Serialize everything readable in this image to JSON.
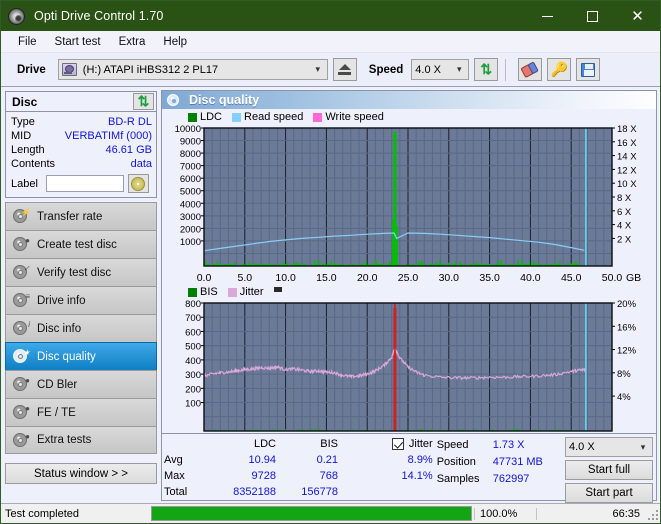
{
  "window": {
    "title": "Opti Drive Control 1.70",
    "icon": "disc-icon",
    "minimize": "minimize-icon",
    "maximize": "maximize-icon",
    "close": "close-icon"
  },
  "menu": [
    {
      "label": "File"
    },
    {
      "label": "Start test"
    },
    {
      "label": "Extra"
    },
    {
      "label": "Help"
    }
  ],
  "toolbar": {
    "drive_label": "Drive",
    "drive_value": "(H:)   ATAPI iHBS312  2 PL17",
    "eject_icon": "eject-icon",
    "speed_label": "Speed",
    "speed_value": "4.0 X",
    "refresh_icon": "refresh-icon",
    "eraser_icon": "eraser-icon",
    "key_icon": "key-icon",
    "save_icon": "save-icon"
  },
  "disc": {
    "title": "Disc",
    "refresh_icon": "refresh-icon",
    "rows": [
      {
        "key": "Type",
        "value": "BD-R DL"
      },
      {
        "key": "MID",
        "value": "VERBATIMf (000)"
      },
      {
        "key": "Length",
        "value": "46.61 GB"
      },
      {
        "key": "Contents",
        "value": "data"
      }
    ],
    "label_key": "Label",
    "label_value": "",
    "label_placeholder": "",
    "disc_icon": "cd-icon"
  },
  "nav": {
    "items": [
      {
        "label": "Transfer rate",
        "icon": "disc-icon",
        "active": false
      },
      {
        "label": "Create test disc",
        "icon": "disc-icon",
        "active": false
      },
      {
        "label": "Verify test disc",
        "icon": "disc-icon",
        "active": false
      },
      {
        "label": "Drive info",
        "icon": "disc-icon",
        "active": false
      },
      {
        "label": "Disc info",
        "icon": "disc-icon",
        "active": false
      },
      {
        "label": "Disc quality",
        "icon": "disc-icon",
        "active": true
      },
      {
        "label": "CD Bler",
        "icon": "disc-icon",
        "active": false
      },
      {
        "label": "FE / TE",
        "icon": "disc-icon",
        "active": false
      },
      {
        "label": "Extra tests",
        "icon": "disc-icon",
        "active": false
      }
    ],
    "status_window": "Status window > >"
  },
  "main": {
    "header_title": "Disc quality",
    "header_icon": "disc-icon"
  },
  "stats": {
    "col_ldc": "LDC",
    "col_bis": "BIS",
    "row_avg": "Avg",
    "row_max": "Max",
    "row_total": "Total",
    "avg_ldc": "10.94",
    "avg_bis": "0.21",
    "max_ldc": "9728",
    "max_bis": "768",
    "total_ldc": "8352188",
    "total_bis": "156778",
    "jitter_label": "Jitter",
    "jitter_checked": true,
    "jitter_avg": "8.9%",
    "jitter_max": "14.1%",
    "speed_label": "Speed",
    "speed_value": "1.73 X",
    "position_label": "Position",
    "position_value": "47731 MB",
    "samples_label": "Samples",
    "samples_value": "762997",
    "speed_select": "4.0 X",
    "start_full": "Start full",
    "start_part": "Start part"
  },
  "statusbar": {
    "text": "Test completed",
    "percent_label": "100.0%",
    "percent_value": 100,
    "time": "66:35",
    "bar_color": "#13a513"
  },
  "chart_data": [
    {
      "type": "line",
      "id": "quality-top-chart",
      "title": "",
      "xlabel": "GB",
      "ylabel": "",
      "xlim": [
        0,
        50
      ],
      "ylim": [
        0,
        10000
      ],
      "y2lim": [
        0,
        18
      ],
      "grid": true,
      "legend_position": "top-left",
      "legend": [
        {
          "name": "LDC",
          "color": "#008000"
        },
        {
          "name": "Read speed",
          "color": "#87cefa"
        },
        {
          "name": "Write speed",
          "color": "#ff69d6"
        }
      ],
      "xticks": [
        "0.0",
        "5.0",
        "10.0",
        "15.0",
        "20.0",
        "25.0",
        "30.0",
        "35.0",
        "40.0",
        "45.0",
        "50.0"
      ],
      "yticks": [
        "10000",
        "9000",
        "8000",
        "7000",
        "6000",
        "5000",
        "4000",
        "3000",
        "2000",
        "1000"
      ],
      "y2ticks": [
        "18 X",
        "16 X",
        "14 X",
        "12 X",
        "10 X",
        "8 X",
        "6 X",
        "4 X",
        "2 X"
      ],
      "plot_bg": "#6b7a96",
      "series": [
        {
          "name": "Read speed",
          "color": "#87cefa",
          "axis": "right",
          "x": [
            0,
            2,
            4,
            6,
            8,
            10,
            12,
            14,
            16,
            18,
            20,
            22,
            23.3,
            23.6,
            25,
            27,
            29,
            31,
            33,
            35,
            37,
            39,
            41,
            43,
            45,
            46.6
          ],
          "values": [
            2.0,
            2.3,
            2.6,
            2.9,
            3.2,
            3.4,
            3.6,
            3.75,
            3.9,
            4.0,
            4.15,
            4.25,
            4.3,
            3.6,
            4.3,
            4.25,
            4.15,
            4.0,
            3.85,
            3.7,
            3.5,
            3.3,
            3.1,
            2.8,
            2.4,
            2.05
          ]
        },
        {
          "name": "LDC",
          "color": "#00c000",
          "axis": "left",
          "peak_x": 23.4,
          "peak_value": 9728,
          "baseline": 120
        }
      ],
      "markers": [
        {
          "name": "end-of-data",
          "x": 46.8,
          "color": "#5fd7f0"
        }
      ]
    },
    {
      "type": "line",
      "id": "quality-bottom-chart",
      "title": "",
      "xlabel": "GB",
      "ylabel": "",
      "xlim": [
        0,
        50
      ],
      "ylim": [
        0,
        800
      ],
      "y2lim": [
        0,
        20
      ],
      "grid": true,
      "legend_position": "top-left",
      "legend": [
        {
          "name": "BIS",
          "color": "#008000"
        },
        {
          "name": "Jitter",
          "color": "#d9a8d9"
        }
      ],
      "xticks": [
        "0.0",
        "5.0",
        "10.0",
        "15.0",
        "20.0",
        "25.0",
        "30.0",
        "35.0",
        "40.0",
        "45.0",
        "50.0"
      ],
      "yticks": [
        "800",
        "700",
        "600",
        "500",
        "400",
        "300",
        "200",
        "100"
      ],
      "y2ticks": [
        "20%",
        "16%",
        "12%",
        "8%",
        "4%"
      ],
      "plot_bg": "#6b7a96",
      "series": [
        {
          "name": "Jitter",
          "color": "#d9a8d9",
          "axis": "right",
          "x": [
            0,
            1,
            2,
            3,
            4,
            5,
            6,
            7,
            8,
            9,
            10,
            11,
            12,
            13,
            14,
            15,
            16,
            17,
            18,
            19,
            20,
            21,
            22,
            23,
            23.4,
            24,
            25,
            26,
            27,
            29,
            31,
            33,
            35,
            37,
            39,
            41,
            43,
            45,
            46,
            46.8
          ],
          "values": [
            8.6,
            8.9,
            9.1,
            9.2,
            9.4,
            9.6,
            9.7,
            9.9,
            9.8,
            10.0,
            9.6,
            9.7,
            9.5,
            9.3,
            9.4,
            9.2,
            9.1,
            8.7,
            8.5,
            8.6,
            8.9,
            9.4,
            10.2,
            11.5,
            13.0,
            11.4,
            10.0,
            9.2,
            8.7,
            8.4,
            8.3,
            8.3,
            8.4,
            8.4,
            8.5,
            8.6,
            8.8,
            9.3,
            9.5,
            9.6
          ]
        },
        {
          "name": "BIS",
          "color": "#00c000",
          "axis": "left",
          "peak_x": 23.4,
          "peak_value": 768,
          "baseline": 4
        }
      ],
      "markers": [
        {
          "name": "bis-spike",
          "x": 23.4,
          "color": "#d02020"
        },
        {
          "name": "end-of-data",
          "x": 46.8,
          "color": "#5fd7f0"
        }
      ]
    }
  ]
}
